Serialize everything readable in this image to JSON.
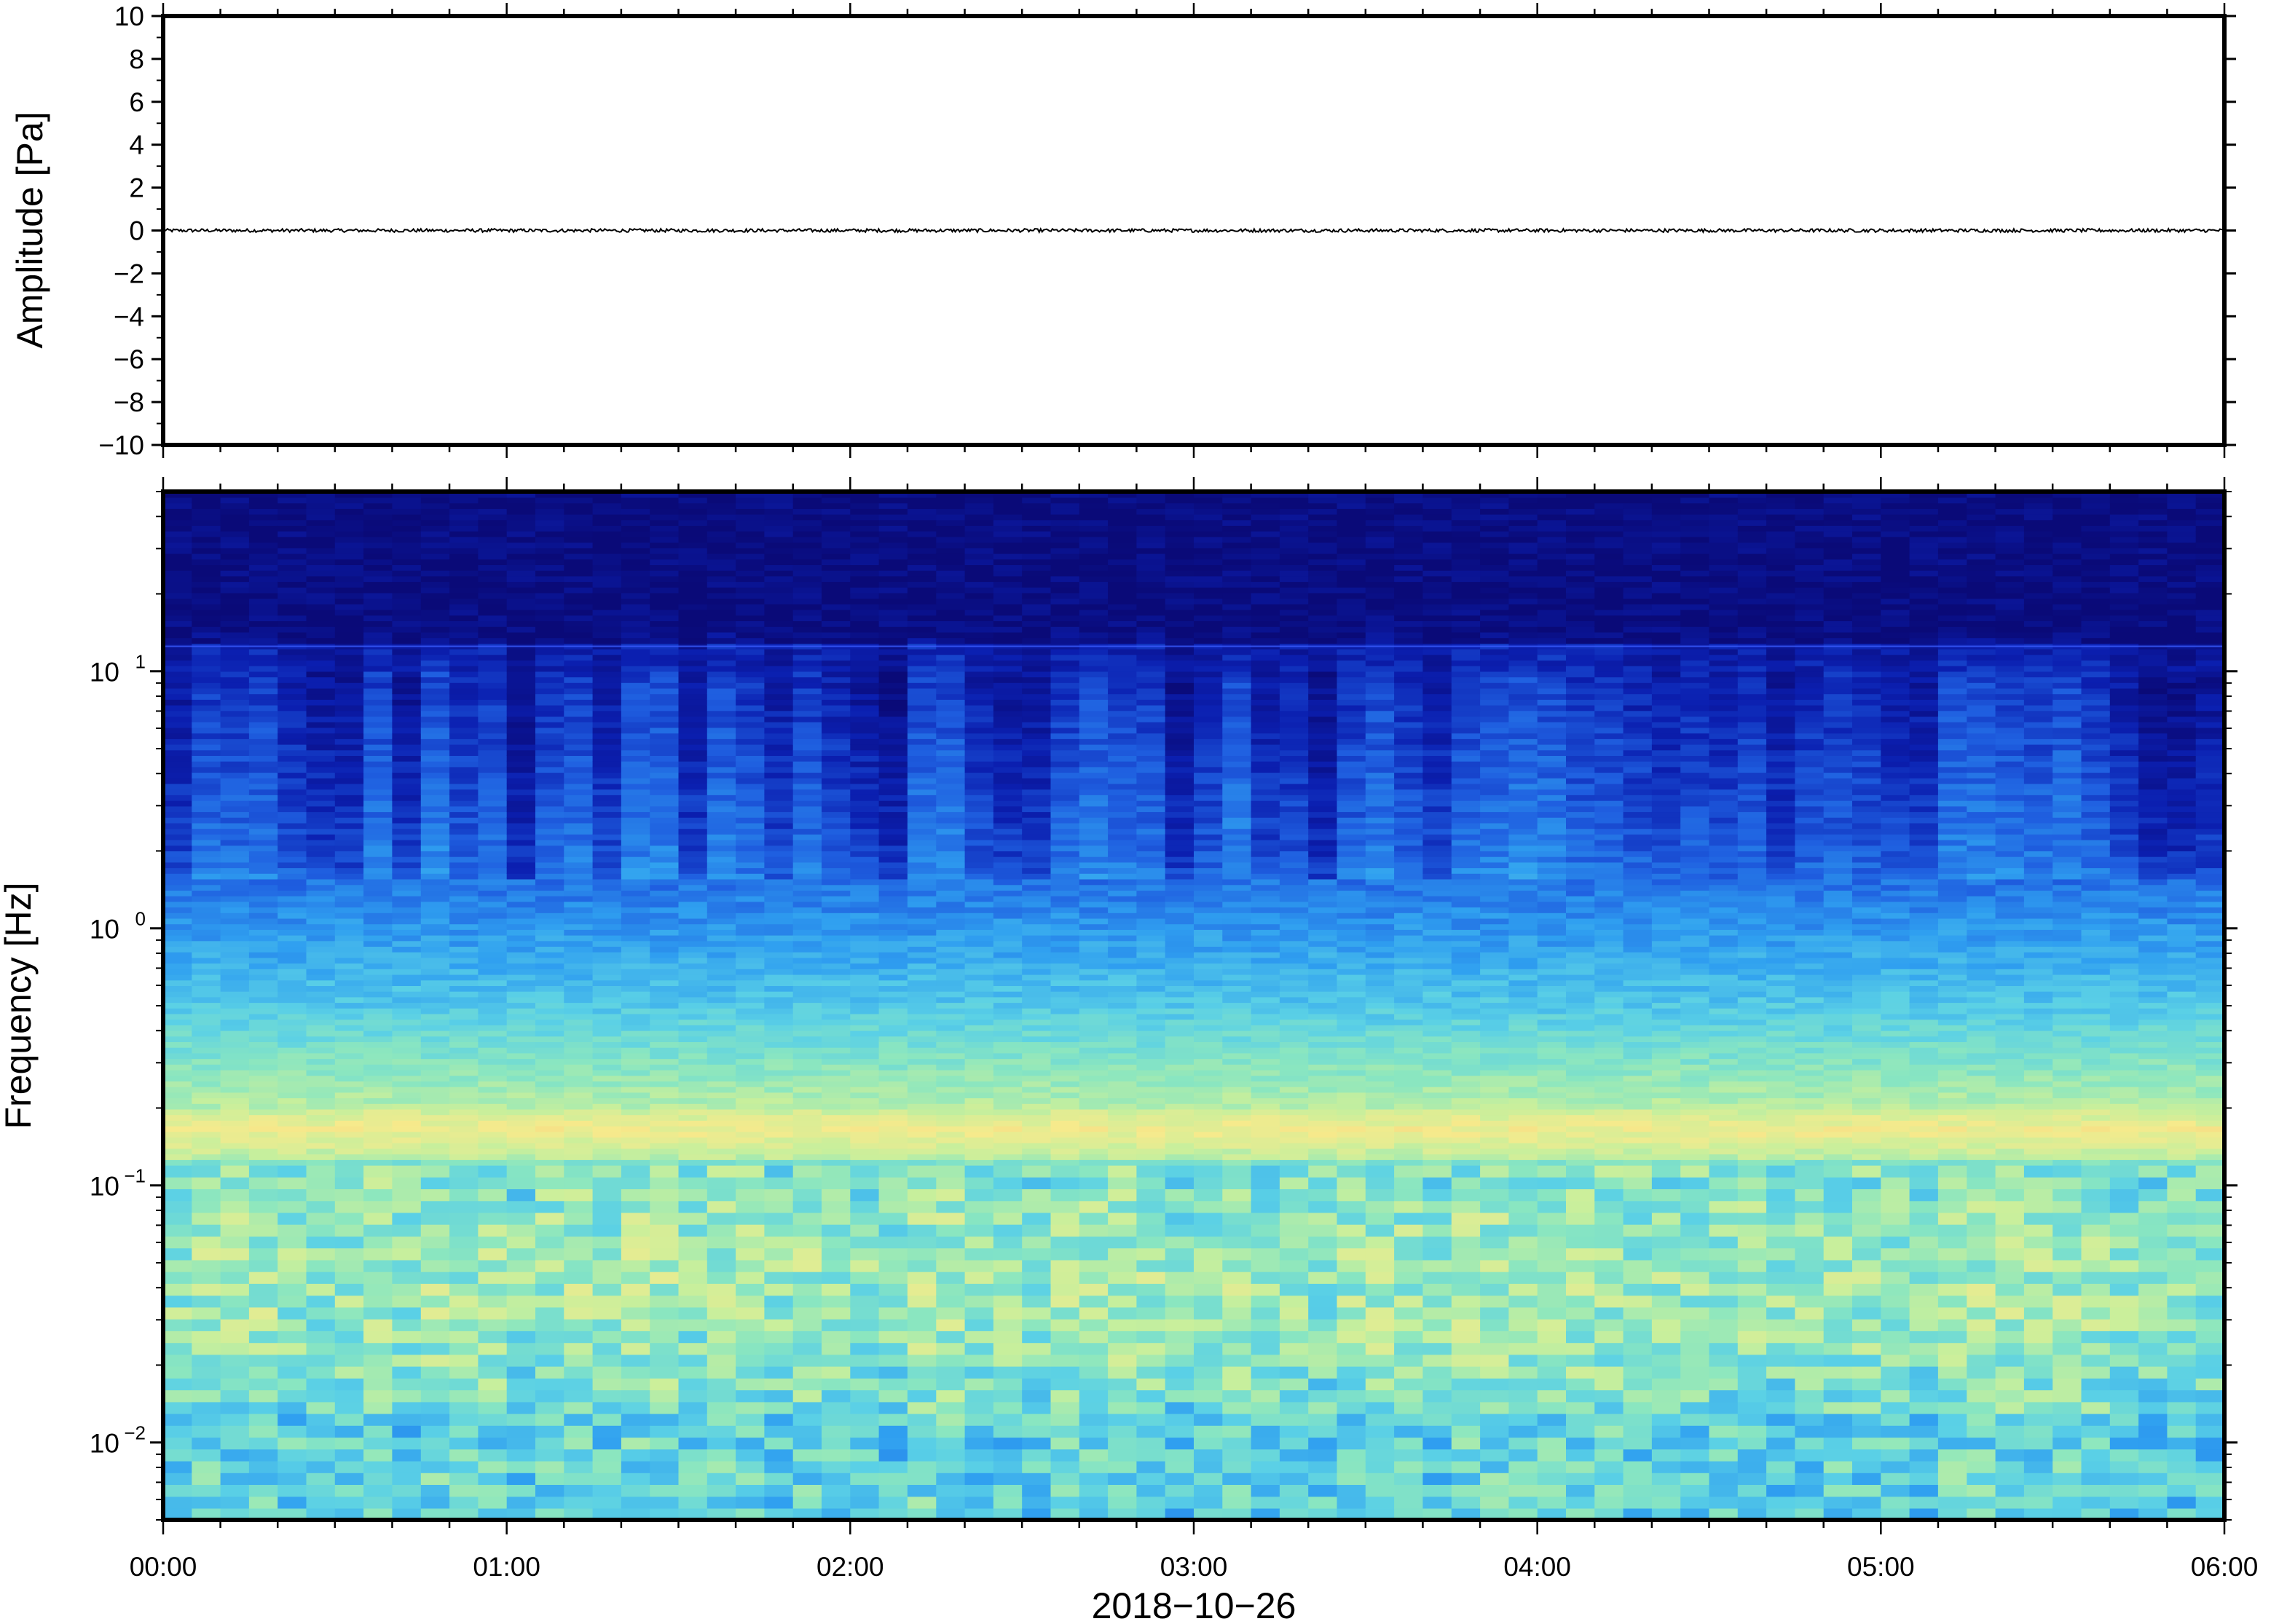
{
  "chart_data": [
    {
      "type": "line",
      "panel": "waveform",
      "ylabel": "Amplitude [Pa]",
      "ylim": [
        -10,
        10
      ],
      "yticks": [
        10,
        8,
        6,
        4,
        2,
        0,
        -2,
        -4,
        -6,
        -8,
        -10
      ],
      "ytick_labels": [
        "10",
        "8",
        "6",
        "4",
        "2",
        "0",
        "−2",
        "−4",
        "−6",
        "−8",
        "−10"
      ],
      "xlim_hours": [
        0,
        6
      ],
      "series": [
        {
          "values_note_free": true,
          "mean": 0,
          "peak_abs": 0.08
        }
      ],
      "line_color": "#000000"
    },
    {
      "type": "heatmap",
      "panel": "spectrogram",
      "ylabel": "Frequency [Hz]",
      "xlabel": "2018−10−26",
      "yscale": "log",
      "ylim": [
        0.005,
        50
      ],
      "yticks": [
        0.01,
        0.1,
        1,
        10
      ],
      "ytick_labels": [
        {
          "base": "10",
          "exp": "−2"
        },
        {
          "base": "10",
          "exp": "−1"
        },
        {
          "base": "10",
          "exp": "0"
        },
        {
          "base": "10",
          "exp": "1"
        }
      ],
      "x_ticks": [
        "00:00",
        "01:00",
        "02:00",
        "03:00",
        "04:00",
        "05:00",
        "06:00"
      ],
      "xlim_hours": [
        0,
        6
      ],
      "colormap": [
        "#0a0a78",
        "#0b1fb0",
        "#1f5fe0",
        "#2f9ff0",
        "#5ad0e6",
        "#8ae6c0",
        "#c8ef9c",
        "#f6ea8c",
        "#f6c878"
      ],
      "line_freq_hz": 12.5
    }
  ]
}
